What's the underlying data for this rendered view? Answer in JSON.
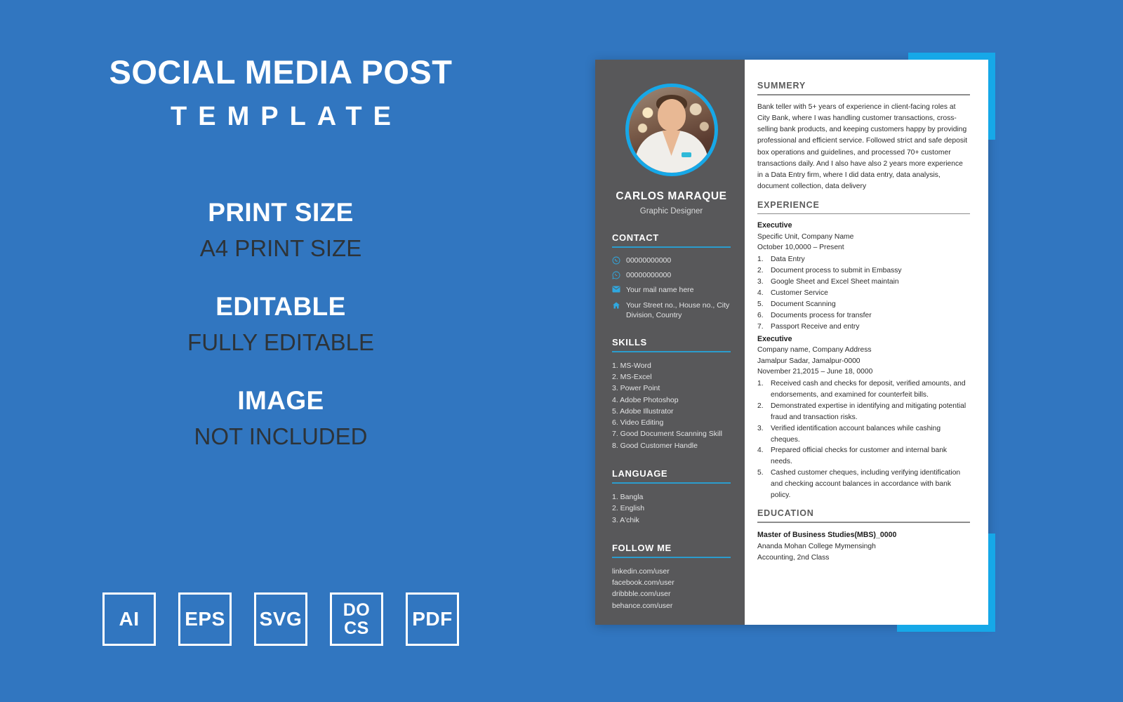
{
  "promo": {
    "title": "SOCIAL MEDIA POST",
    "subtitle": "TEMPLATE",
    "features": [
      {
        "head": "PRINT SIZE",
        "sub": "A4 PRINT SIZE"
      },
      {
        "head": "EDITABLE",
        "sub": "FULLY EDITABLE"
      },
      {
        "head": "IMAGE",
        "sub": "NOT INCLUDED"
      }
    ],
    "badges": [
      {
        "label": "AI",
        "lines": [
          "AI"
        ]
      },
      {
        "label": "EPS",
        "lines": [
          "EPS"
        ]
      },
      {
        "label": "SVG",
        "lines": [
          "SVG"
        ]
      },
      {
        "label": "DOCS",
        "lines": [
          "DO",
          "CS"
        ]
      },
      {
        "label": "PDF",
        "lines": [
          "PDF"
        ]
      }
    ]
  },
  "colors": {
    "background": "#3176c0",
    "accent_cyan": "#16a8e8",
    "sidebar_gray": "#58585a",
    "rule_blue": "#2b9ccd",
    "dark_text": "#2d3338"
  },
  "resume": {
    "sidebar": {
      "name": "CARLOS MARAQUE",
      "role": "Graphic Designer",
      "contact": {
        "heading": "CONTACT",
        "items": [
          {
            "icon": "phone-icon",
            "text": "00000000000"
          },
          {
            "icon": "whatsapp-icon",
            "text": "00000000000"
          },
          {
            "icon": "mail-icon",
            "text": "Your mail name here"
          },
          {
            "icon": "home-icon",
            "text": "Your Street no., House no., City Division, Country"
          }
        ]
      },
      "skills": {
        "heading": "SKILLS",
        "items": [
          "1. MS-Word",
          "2. MS-Excel",
          "3. Power Point",
          "4. Adobe Photoshop",
          "5. Adobe Illustrator",
          "6. Video Editing",
          "7. Good Document Scanning Skill",
          "8. Good Customer Handle"
        ]
      },
      "language": {
        "heading": "LANGUAGE",
        "items": [
          "1. Bangla",
          "2. English",
          "3. A'chik"
        ]
      },
      "follow": {
        "heading": "FOLLOW ME",
        "items": [
          "linkedin.com/user",
          "facebook.com/user",
          "dribbble.com/user",
          "behance.com/user"
        ]
      }
    },
    "main": {
      "summary": {
        "heading": "SUMMERY",
        "body": "Bank teller with 5+ years of experience in client-facing roles at City Bank, where I was handling customer transactions, cross-selling bank products, and keeping customers happy by providing professional and efficient service. Followed strict and safe deposit box operations and guidelines, and processed 70+ customer transactions daily. And I also have also 2 years more experience in a Data Entry firm, where I did data entry, data analysis, document collection, data delivery"
      },
      "experience": {
        "heading": "EXPERIENCE",
        "jobs": [
          {
            "title": "Executive",
            "lines": [
              "Specific Unit, Company Name",
              "October 10,0000 – Present"
            ],
            "bullets": [
              "Data Entry",
              "Document process to submit in Embassy",
              "Google Sheet and Excel Sheet maintain",
              "Customer Service",
              "Document Scanning",
              "Documents process for transfer",
              "Passport Receive and entry"
            ]
          },
          {
            "title": "Executive",
            "lines": [
              "Company name, Company Address",
              "Jamalpur Sadar, Jamalpur-0000",
              "November 21,2015 – June 18, 0000"
            ],
            "bullets": [
              "Received cash and checks for deposit, verified amounts, and endorsements, and examined for counterfeit bills.",
              "Demonstrated expertise in identifying and mitigating potential fraud and transaction risks.",
              "Verified identification account balances while cashing cheques.",
              "Prepared official checks for customer and internal bank needs.",
              "Cashed customer cheques, including verifying identification and checking account balances in accordance with bank policy."
            ]
          }
        ]
      },
      "education": {
        "heading": "EDUCATION",
        "title": "Master of Business Studies(MBS)_0000",
        "lines": [
          "Ananda Mohan College Mymensingh",
          "Accounting, 2nd Class"
        ]
      }
    }
  }
}
